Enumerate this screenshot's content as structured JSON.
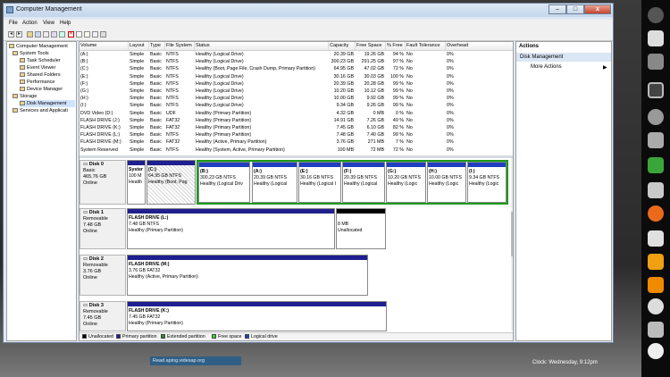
{
  "window": {
    "title": "Computer Management",
    "min_label": "–",
    "max_label": "□",
    "close_label": "x"
  },
  "menu": [
    "File",
    "Action",
    "View",
    "Help"
  ],
  "tree": {
    "root": "Computer Management",
    "system_tools": "System Tools",
    "task_scheduler": "Task Scheduler",
    "event_viewer": "Event Viewer",
    "shared_folders": "Shared Folders",
    "performance": "Performance",
    "device_manager": "Device Manager",
    "storage": "Storage",
    "disk_management": "Disk Management",
    "services": "Services and Applicati"
  },
  "volumes": {
    "columns": [
      "Volume",
      "Layout",
      "Type",
      "File System",
      "Status",
      "Capacity",
      "Free Space",
      "% Free",
      "Fault Tolerance",
      "Overhead"
    ],
    "rows": [
      [
        "(A:)",
        "Simple",
        "Basic",
        "NTFS",
        "Healthy (Logical Drive)",
        "20.39 GB",
        "19.26 GB",
        "94 %",
        "No",
        "0%"
      ],
      [
        "(B:)",
        "Simple",
        "Basic",
        "NTFS",
        "Healthy (Logical Drive)",
        "300.23 GB",
        "291.25 GB",
        "97 %",
        "No",
        "0%"
      ],
      [
        "(C:)",
        "Simple",
        "Basic",
        "NTFS",
        "Healthy (Boot, Page File, Crash Dump, Primary Partition)",
        "64.95 GB",
        "47.02 GB",
        "72 %",
        "No",
        "0%"
      ],
      [
        "(E:)",
        "Simple",
        "Basic",
        "NTFS",
        "Healthy (Logical Drive)",
        "30.16 GB",
        "30.03 GB",
        "100 %",
        "No",
        "0%"
      ],
      [
        "(F:)",
        "Simple",
        "Basic",
        "NTFS",
        "Healthy (Logical Drive)",
        "20.39 GB",
        "20.28 GB",
        "99 %",
        "No",
        "0%"
      ],
      [
        "(G:)",
        "Simple",
        "Basic",
        "NTFS",
        "Healthy (Logical Drive)",
        "10.20 GB",
        "10.12 GB",
        "99 %",
        "No",
        "0%"
      ],
      [
        "(H:)",
        "Simple",
        "Basic",
        "NTFS",
        "Healthy (Logical Drive)",
        "10.00 GB",
        "9.92 GB",
        "99 %",
        "No",
        "0%"
      ],
      [
        "(I:)",
        "Simple",
        "Basic",
        "NTFS",
        "Healthy (Logical Drive)",
        "9.34 GB",
        "9.26 GB",
        "99 %",
        "No",
        "0%"
      ],
      [
        "DVD Video (D:)",
        "Simple",
        "Basic",
        "UDF",
        "Healthy (Primary Partition)",
        "4.32 GB",
        "0 MB",
        "0 %",
        "No",
        "0%"
      ],
      [
        "FLASH DRIVE (J:)",
        "Simple",
        "Basic",
        "FAT32",
        "Healthy (Primary Partition)",
        "14.91 GB",
        "7.26 GB",
        "49 %",
        "No",
        "0%"
      ],
      [
        "FLASH DRIVE (K:)",
        "Simple",
        "Basic",
        "FAT32",
        "Healthy (Primary Partition)",
        "7.45 GB",
        "6.10 GB",
        "82 %",
        "No",
        "0%"
      ],
      [
        "FLASH DRIVE (L:)",
        "Simple",
        "Basic",
        "NTFS",
        "Healthy (Primary Partition)",
        "7.48 GB",
        "7.40 GB",
        "99 %",
        "No",
        "0%"
      ],
      [
        "FLASH DRIVE (M:)",
        "Simple",
        "Basic",
        "FAT32",
        "Healthy (Active, Primary Partition)",
        "3.76 GB",
        "271 MB",
        "7 %",
        "No",
        "0%"
      ],
      [
        "System Reserved",
        "Simple",
        "Basic",
        "NTFS",
        "Healthy (System, Active, Primary Partition)",
        "100 MB",
        "72 MB",
        "72 %",
        "No",
        "0%"
      ]
    ]
  },
  "disks": [
    {
      "name": "Disk 0",
      "type": "Basic",
      "size": "465.76 GB",
      "status": "Online",
      "partitions": [
        {
          "title": "Syster",
          "line1": "100 M",
          "line2": "Health"
        },
        {
          "title": "(C:)",
          "line1": "64.95 GB NTFS",
          "line2": "Healthy (Boot, Pag"
        },
        {
          "title": "(B:)",
          "line1": "300.23 GB NTFS",
          "line2": "Healthy (Logical Driv"
        },
        {
          "title": "(A:)",
          "line1": "20.39 GB NTFS",
          "line2": "Healthy (Logical"
        },
        {
          "title": "(E:)",
          "line1": "30.16 GB NTFS",
          "line2": "Healthy (Logical I"
        },
        {
          "title": "(F:)",
          "line1": "20.39 GB NTFS",
          "line2": "Healthy (Logical"
        },
        {
          "title": "(G:)",
          "line1": "10.20 GB NTFS",
          "line2": "Healthy (Logic"
        },
        {
          "title": "(H:)",
          "line1": "10.00 GB NTFS",
          "line2": "Healthy (Logic"
        },
        {
          "title": "(I:)",
          "line1": "9.34 GB NTFS",
          "line2": "Healthy (Logic"
        }
      ]
    },
    {
      "name": "Disk 1",
      "type": "Removable",
      "size": "7.48 GB",
      "status": "Online",
      "partitions": [
        {
          "title": "FLASH DRIVE  (L:)",
          "line1": "7.48 GB NTFS",
          "line2": "Healthy (Primary Partition)"
        },
        {
          "title": "",
          "line1": "8 MB",
          "line2": "Unallocated"
        }
      ]
    },
    {
      "name": "Disk 2",
      "type": "Removable",
      "size": "3.76 GB",
      "status": "Online",
      "partitions": [
        {
          "title": "FLASH DRIVE  (M:)",
          "line1": "3.76 GB FAT32",
          "line2": "Healthy (Active, Primary Partition)"
        }
      ]
    },
    {
      "name": "Disk 3",
      "type": "Removable",
      "size": "7.45 GB",
      "status": "Online",
      "partitions": [
        {
          "title": "FLASH DRIVE  (K:)",
          "line1": "7.45 GB FAT32",
          "line2": "Healthy (Primary Partition)"
        }
      ]
    }
  ],
  "legend": [
    {
      "label": "Unallocated",
      "color": "#000000"
    },
    {
      "label": "Primary partition",
      "color": "#1f1f8f"
    },
    {
      "label": "Extended partition",
      "color": "#2e8b2e"
    },
    {
      "label": "Free space",
      "color": "#39d639"
    },
    {
      "label": "Logical drive",
      "color": "#1f3fbf"
    }
  ],
  "actions": {
    "header": "Actions",
    "section": "Disk Management",
    "more": "More Actions",
    "arrow": "▶"
  },
  "taskbar": {
    "status_text": "Read aping.videsap.org",
    "clock": "Clock: Wednesday, 9:12pm"
  },
  "colors": {
    "primary_bar": "#1f1f8f",
    "logical_bar": "#1f3fbf",
    "extended_border": "#1a9a1a",
    "unallocated_bar": "#000000"
  }
}
